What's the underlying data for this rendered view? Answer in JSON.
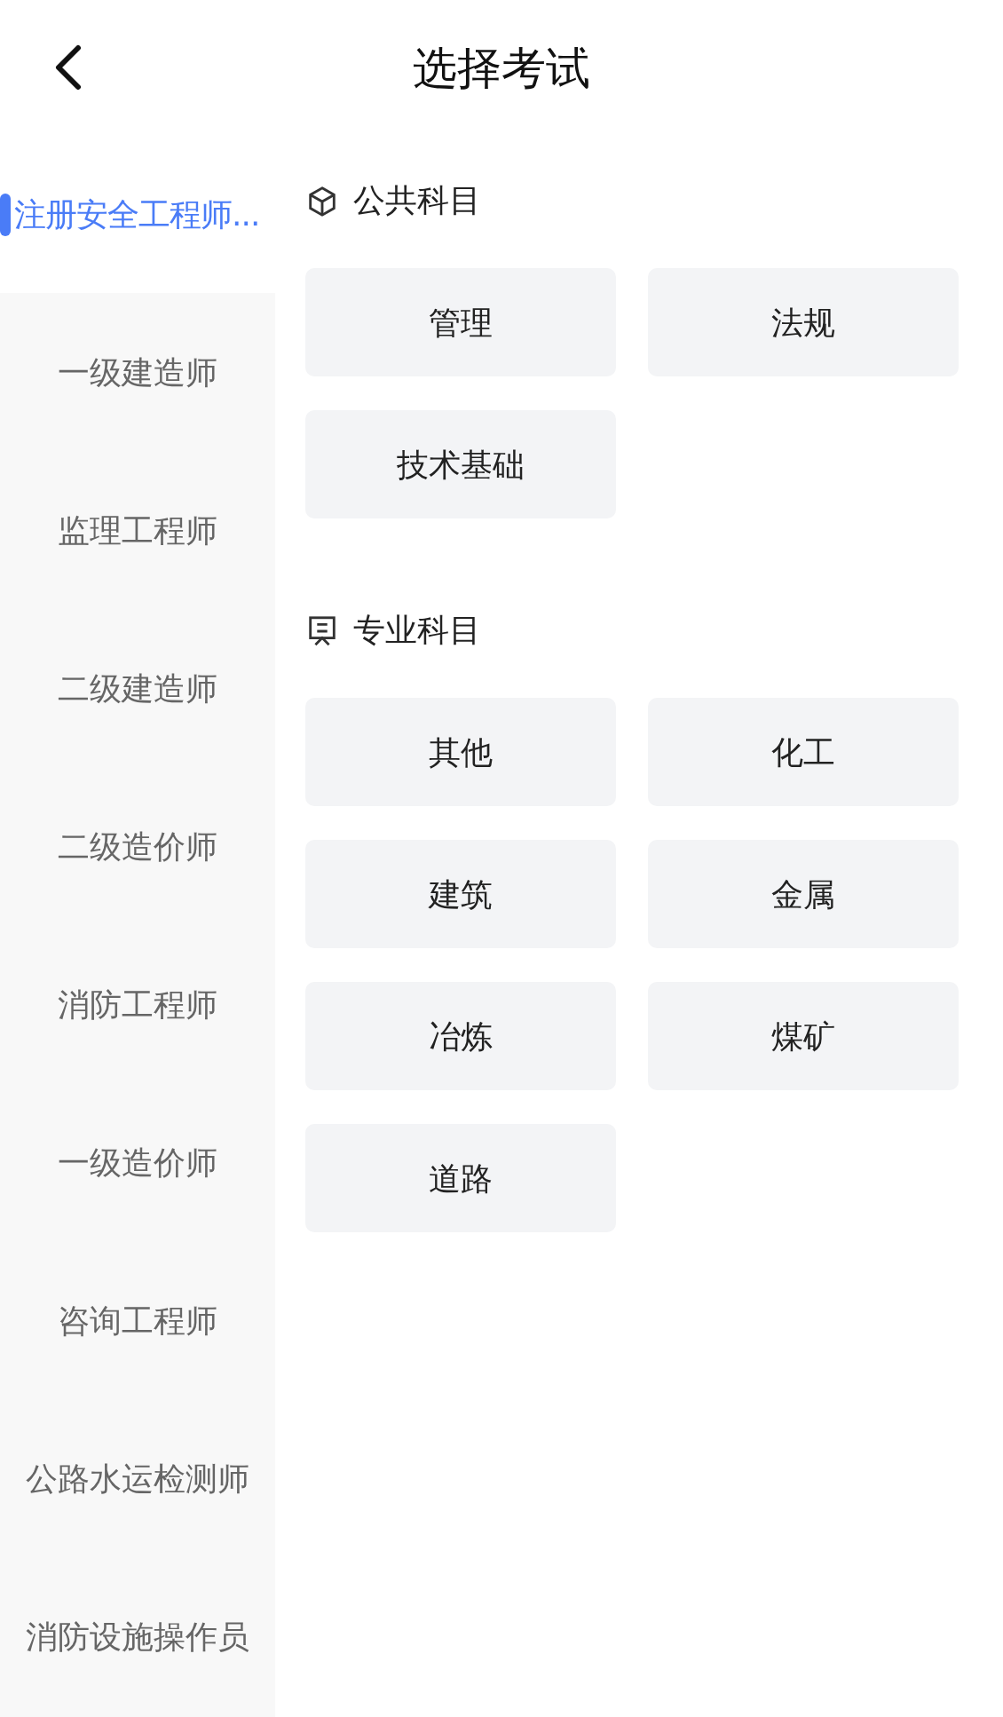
{
  "header": {
    "title": "选择考试"
  },
  "sidebar": {
    "items": [
      {
        "label": "注册安全工程师...",
        "selected": true
      },
      {
        "label": "一级建造师",
        "selected": false
      },
      {
        "label": "监理工程师",
        "selected": false
      },
      {
        "label": "二级建造师",
        "selected": false
      },
      {
        "label": "二级造价师",
        "selected": false
      },
      {
        "label": "消防工程师",
        "selected": false
      },
      {
        "label": "一级造价师",
        "selected": false
      },
      {
        "label": "咨询工程师",
        "selected": false
      },
      {
        "label": "公路水运检测师",
        "selected": false
      },
      {
        "label": "消防设施操作员",
        "selected": false
      }
    ]
  },
  "sections": [
    {
      "kind": "public",
      "title": "公共科目",
      "subjects": [
        "管理",
        "法规",
        "技术基础"
      ]
    },
    {
      "kind": "professional",
      "title": "专业科目",
      "subjects": [
        "其他",
        "化工",
        "建筑",
        "金属",
        "冶炼",
        "煤矿",
        "道路"
      ]
    }
  ]
}
